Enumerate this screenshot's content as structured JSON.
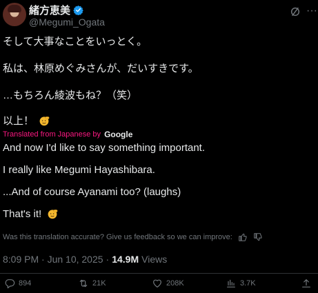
{
  "author": {
    "display_name": "緒方恵美",
    "handle": "@Megumi_Ogata",
    "verified": true
  },
  "original_text": [
    "そして大事なことをいっとく。",
    "私は、林原めぐみさんが、だいすきです。",
    "…もちろん綾波もね？（笑）",
    "以上！"
  ],
  "translation": {
    "label": "Translated from Japanese by",
    "provider": "Google",
    "lines": [
      "And now I'd like to say something important.",
      "I really like Megumi Hayashibara.",
      "...And of course Ayanami too? (laughs)",
      "That's it!"
    ],
    "feedback_prompt": "Was this translation accurate? Give us feedback so we can improve:"
  },
  "meta": {
    "timestamp": "8:09 PM · Jun 10, 2025",
    "separator": "·",
    "views_count": "14.9M",
    "views_label": "Views"
  },
  "actions": {
    "replies": "894",
    "reposts": "21K",
    "likes": "208K",
    "bookmarks": "3.7K"
  },
  "colors": {
    "background": "#000000",
    "text": "#e7e9ea",
    "muted": "#71767b",
    "translation_label": "#f91880",
    "verified": "#1d9bf0"
  },
  "icons": [
    "verified-badge-icon",
    "grok-icon",
    "more-icon",
    "salute-emoji-icon",
    "thumbs-up-icon",
    "thumbs-down-icon",
    "reply-icon",
    "repost-icon",
    "like-icon",
    "bookmark-icon",
    "share-icon"
  ]
}
